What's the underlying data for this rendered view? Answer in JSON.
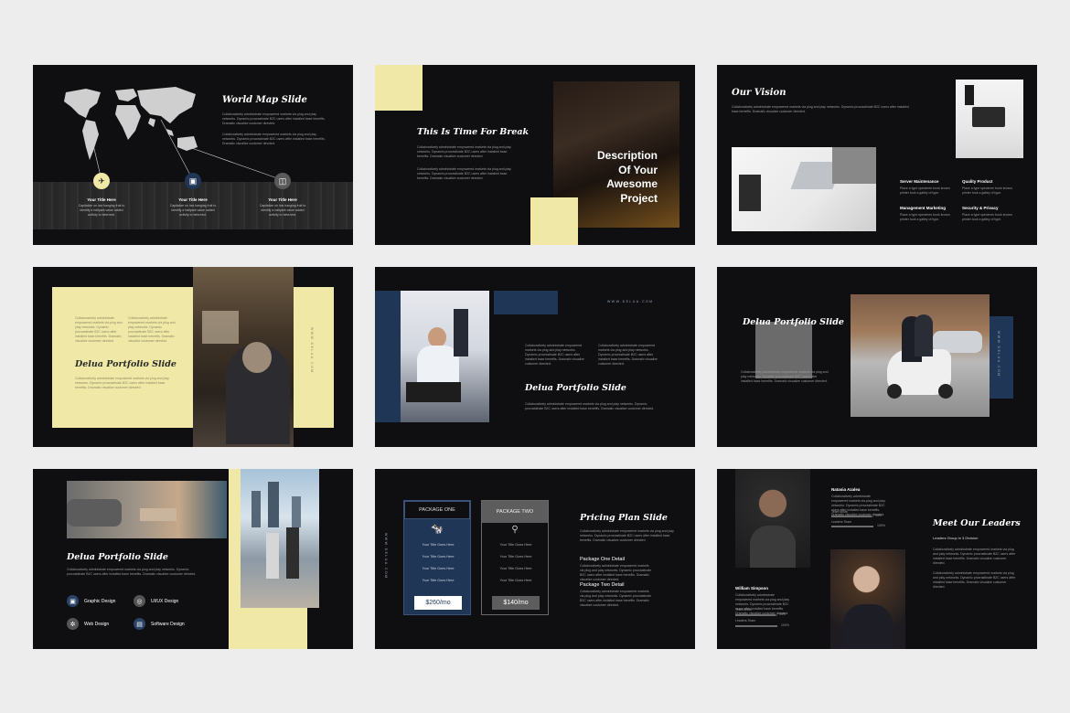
{
  "colors": {
    "slide_bg": "#0f0f11",
    "yellow": "#efe8a7",
    "navy": "#1f3656",
    "page_bg": "#ededee"
  },
  "lorem": "Collaboratively administrate empowered markets via plug and play networks. Dynamic procrastinate B2C users after installed base benefits. Dramatic visualize customer directed.",
  "slide1": {
    "title": "World Map Slide",
    "items": [
      {
        "icon": "plane-icon",
        "title": "Your Title Here",
        "text": "Capitalize on low hanging fruit to identify a ballpark value added activity to beta test."
      },
      {
        "icon": "briefcase-icon",
        "title": "Your Title Here",
        "text": "Capitalize on low hanging fruit to identify a ballpark value added activity to beta test."
      },
      {
        "icon": "cup-icon",
        "title": "Your Title Here",
        "text": "Capitalize on low hanging fruit to identify a ballpark value added activity to beta test."
      }
    ]
  },
  "slide2": {
    "title": "This Is Time For Break",
    "overlay": [
      "Description",
      "Of Your",
      "Awesome",
      "Project"
    ]
  },
  "slide3": {
    "title": "Our Vision",
    "features": [
      "Server Maintenance",
      "Quality Product",
      "Management Marketing",
      "Security & Privacy"
    ],
    "feature_text": "Place a type specimen book known printer took a galley of type."
  },
  "slide4": {
    "title": "Delua Portfolio Slide",
    "vertical": "WWW.DELUA.COM"
  },
  "slide5": {
    "title": "Delua Portfolio Slide",
    "url": "WWW.DELUA.COM"
  },
  "slide6": {
    "title": "Delua Portfolio Slide",
    "vertical": "WWW.DELUA.COM"
  },
  "slide7": {
    "title": "Delua Portfolio Slide",
    "services": [
      {
        "icon": "briefcase-icon",
        "label": "Graphic Design"
      },
      {
        "icon": "globe-icon",
        "label": "UI/UX Design"
      },
      {
        "icon": "gear-icon",
        "label": "Web Design"
      },
      {
        "icon": "bag-icon",
        "label": "Software Design"
      }
    ]
  },
  "slide8": {
    "title": "Pricing Plan Slide",
    "vertical": "WWW.DELUA.COM",
    "plan_one": {
      "name": "PACKAGE ONE",
      "price": "$260/mo",
      "icon": "cow-icon"
    },
    "plan_two": {
      "name": "PACKAGE TWO",
      "price": "$140/mo",
      "icon": "bicycle-icon"
    },
    "row_label": "Your Title Goes Here",
    "detail_one": "Package One Detail",
    "detail_two": "Package Two Detail"
  },
  "slide9": {
    "title": "Meet Our Leaders",
    "subtitle": "Leaders Group in 3 Division",
    "leader_one": {
      "name": "Natasia Azalea",
      "skill_a": "Team Work",
      "skill_b": "Leaders Team",
      "pct_a": "95%",
      "pct_b": "100%",
      "val_a": 0.95,
      "val_b": 1.0
    },
    "leader_two": {
      "name": "William Simpson",
      "skill_a": "Team Work",
      "skill_b": "Leaders Team",
      "pct_a": "95%",
      "pct_b": "100%",
      "val_a": 0.95,
      "val_b": 1.0
    }
  }
}
